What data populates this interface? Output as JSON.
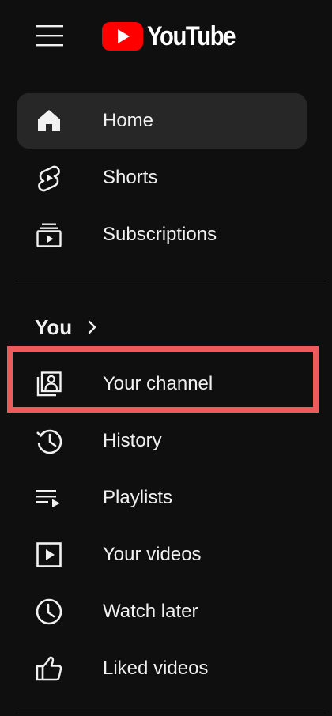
{
  "header": {
    "logo_text": "YouTube",
    "logo_color": "#ff0000"
  },
  "primary_nav": [
    {
      "label": "Home",
      "icon": "home-icon",
      "active": true
    },
    {
      "label": "Shorts",
      "icon": "shorts-icon",
      "active": false
    },
    {
      "label": "Subscriptions",
      "icon": "subscriptions-icon",
      "active": false
    }
  ],
  "you_section": {
    "title": "You",
    "chevron_icon": "chevron-right-icon",
    "items": [
      {
        "label": "Your channel",
        "icon": "your-channel-icon",
        "highlighted": true
      },
      {
        "label": "History",
        "icon": "history-icon"
      },
      {
        "label": "Playlists",
        "icon": "playlists-icon"
      },
      {
        "label": "Your videos",
        "icon": "your-videos-icon"
      },
      {
        "label": "Watch later",
        "icon": "watch-later-icon"
      },
      {
        "label": "Liked videos",
        "icon": "liked-videos-icon"
      }
    ]
  },
  "colors": {
    "background": "#0f0f0f",
    "active_item": "#272727",
    "highlight_border": "#ef5a5a",
    "text": "#f1f1f1"
  }
}
